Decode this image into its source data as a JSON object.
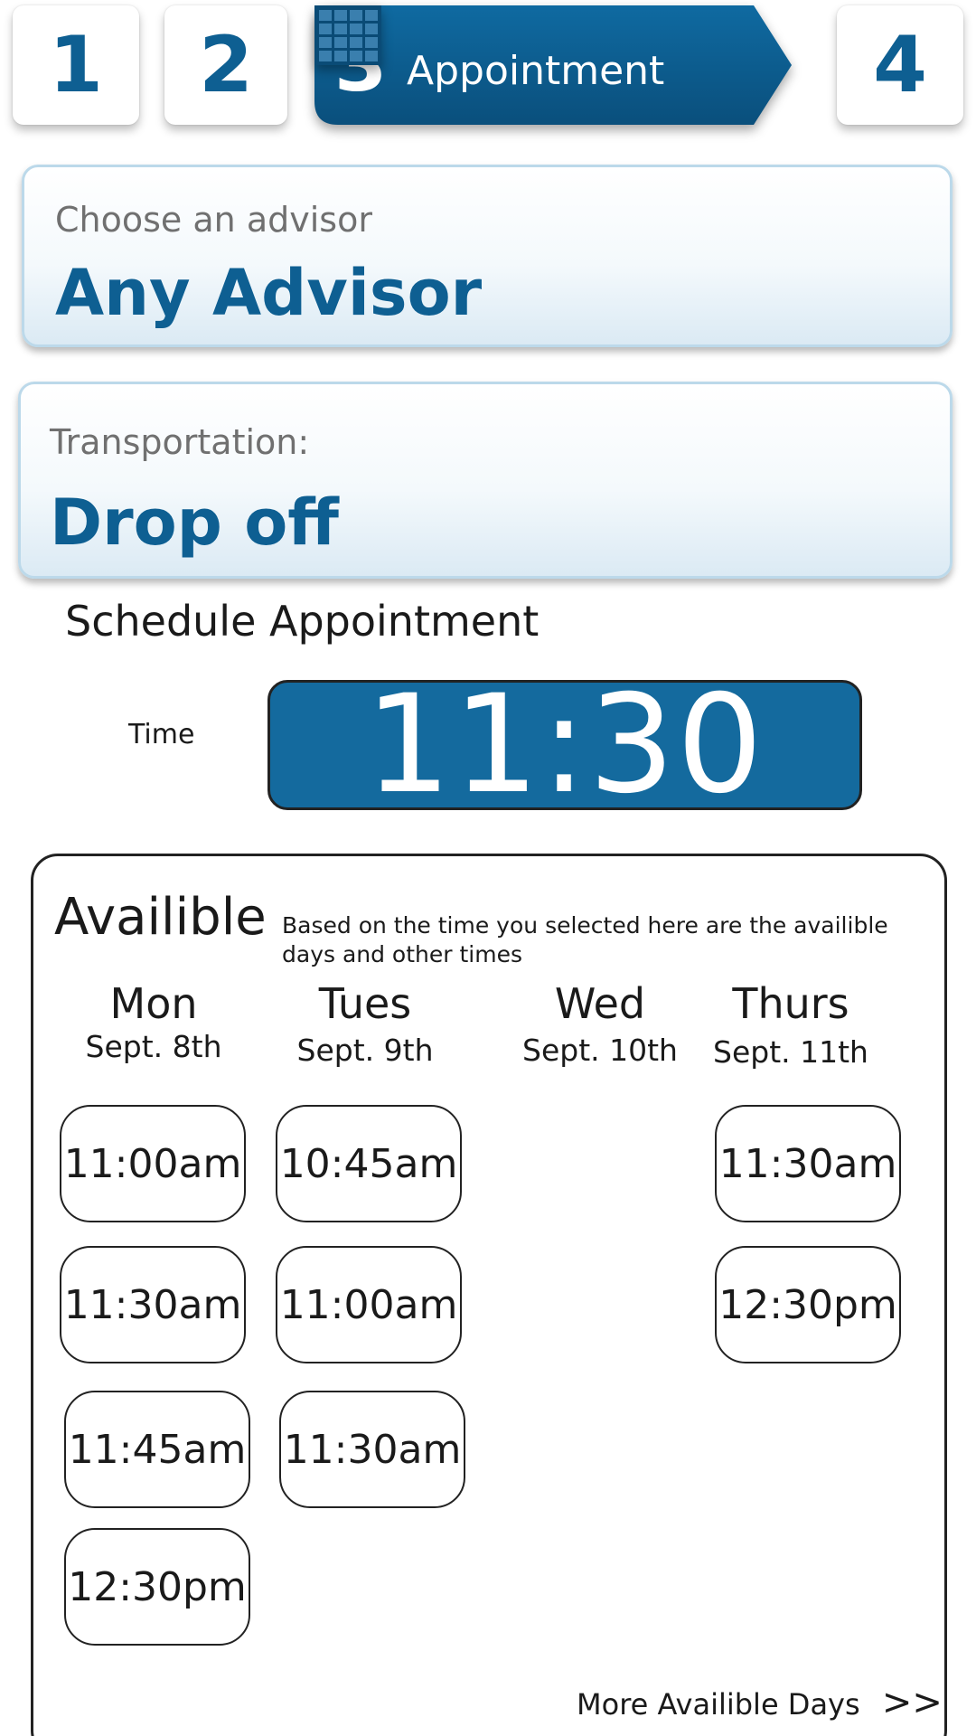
{
  "stepper": {
    "steps": [
      {
        "number": "1"
      },
      {
        "number": "2"
      },
      {
        "number": "3",
        "label": "Appointment",
        "active": true,
        "icon": "calendar-icon"
      },
      {
        "number": "4"
      }
    ],
    "colors": {
      "active": "#0e5f92",
      "number": "#0e5f92"
    }
  },
  "advisor": {
    "caption": "Choose an advisor",
    "value": "Any Advisor"
  },
  "transportation": {
    "caption": "Transportation:",
    "value": "Drop off"
  },
  "schedule": {
    "title": "Schedule Appointment",
    "time_label": "Time",
    "time_value": "11:30"
  },
  "available": {
    "title": "Availible",
    "description": "Based on the time you selected here are the availible days and other times",
    "days": [
      {
        "name": "Mon",
        "date": "Sept. 8th",
        "slots": [
          "11:00am",
          "11:30am",
          "11:45am",
          "12:30pm"
        ]
      },
      {
        "name": "Tues",
        "date": "Sept. 9th",
        "slots": [
          "10:45am",
          "11:00am",
          "11:30am"
        ]
      },
      {
        "name": "Wed",
        "date": "Sept. 10th",
        "slots": []
      },
      {
        "name": "Thurs",
        "date": "Sept. 11th",
        "slots": [
          "11:30am",
          "12:30pm"
        ]
      }
    ],
    "more_label": "More Availible Days",
    "more_arrows": ">>"
  }
}
